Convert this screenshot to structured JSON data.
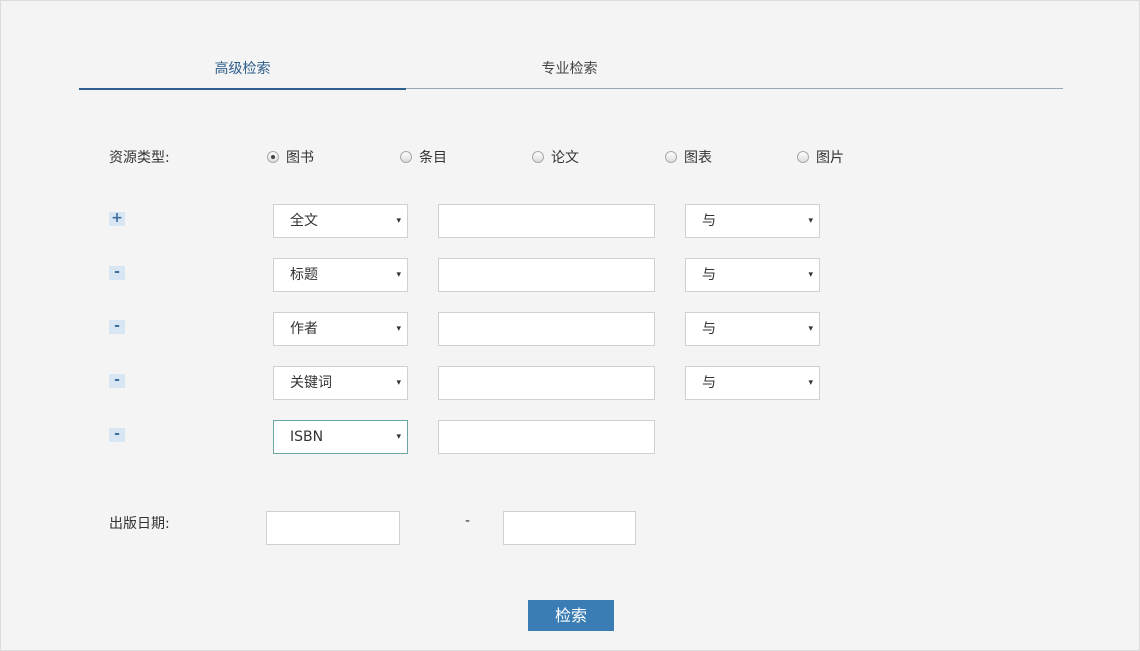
{
  "tabs": [
    {
      "label": "高级检索"
    },
    {
      "label": "专业检索"
    }
  ],
  "resource_type": {
    "label": "资源类型:",
    "options": [
      {
        "label": "图书",
        "checked": true
      },
      {
        "label": "条目",
        "checked": false
      },
      {
        "label": "论文",
        "checked": false
      },
      {
        "label": "图表",
        "checked": false
      },
      {
        "label": "图片",
        "checked": false
      }
    ]
  },
  "rows": [
    {
      "toggle": "+",
      "field": "全文",
      "logic": "与"
    },
    {
      "toggle": "-",
      "field": "标题",
      "logic": "与"
    },
    {
      "toggle": "-",
      "field": "作者",
      "logic": "与"
    },
    {
      "toggle": "-",
      "field": "关键词",
      "logic": "与"
    },
    {
      "toggle": "-",
      "field": "ISBN"
    }
  ],
  "arrow_glyph": "▾",
  "publish_date": {
    "label": "出版日期:",
    "separator": "-"
  },
  "search_button": "检索"
}
